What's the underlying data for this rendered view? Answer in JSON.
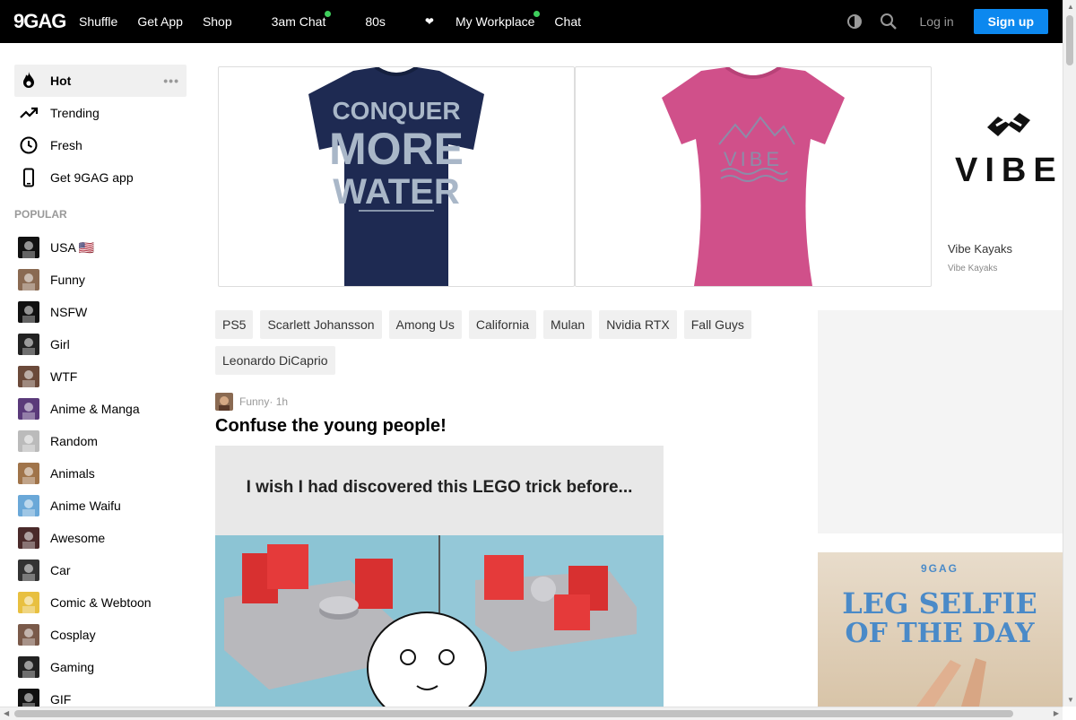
{
  "header": {
    "logo": "9GAG",
    "nav": [
      {
        "glyph": "",
        "label": "Shuffle",
        "dot": false
      },
      {
        "glyph": "",
        "label": "Get App",
        "dot": false
      },
      {
        "glyph": "",
        "label": "Shop",
        "dot": false
      },
      {
        "glyph": "",
        "label": "",
        "dot": false
      },
      {
        "glyph": "",
        "label": "3am Chat",
        "dot": true
      },
      {
        "glyph": "",
        "label": "",
        "dot": false
      },
      {
        "glyph": "",
        "label": "80s",
        "dot": false
      },
      {
        "glyph": "",
        "label": "",
        "dot": false
      },
      {
        "glyph": "❤",
        "label": "",
        "dot": false
      },
      {
        "glyph": "",
        "label": "My Workplace",
        "dot": true
      },
      {
        "glyph": "",
        "label": "Chat",
        "dot": false
      }
    ],
    "login": "Log in",
    "signup": "Sign up"
  },
  "sidebar": {
    "primary": [
      {
        "label": "Hot",
        "icon": "fire-icon"
      },
      {
        "label": "Trending",
        "icon": "trending-icon"
      },
      {
        "label": "Fresh",
        "icon": "clock-icon"
      },
      {
        "label": "Get 9GAG app",
        "icon": "phone-icon"
      }
    ],
    "more": "•••",
    "popular_heading": "POPULAR",
    "popular": [
      {
        "label": "USA 🇺🇸",
        "color": "#111111"
      },
      {
        "label": "Funny",
        "color": "#8a6a52"
      },
      {
        "label": "NSFW",
        "color": "#111111"
      },
      {
        "label": "Girl",
        "color": "#222222"
      },
      {
        "label": "WTF",
        "color": "#6b4a3a"
      },
      {
        "label": "Anime & Manga",
        "color": "#5a3a7a"
      },
      {
        "label": "Random",
        "color": "#bbbbbb"
      },
      {
        "label": "Animals",
        "color": "#a0744a"
      },
      {
        "label": "Anime Waifu",
        "color": "#6aa8d8"
      },
      {
        "label": "Awesome",
        "color": "#4a2a2a"
      },
      {
        "label": "Car",
        "color": "#333333"
      },
      {
        "label": "Comic & Webtoon",
        "color": "#e8c040"
      },
      {
        "label": "Cosplay",
        "color": "#7a5a4a"
      },
      {
        "label": "Gaming",
        "color": "#222222"
      },
      {
        "label": "GIF",
        "color": "#111111"
      }
    ]
  },
  "ad": {
    "shirt1_text": [
      "CONQUER",
      "MORE",
      "WATER"
    ],
    "shirt2_text": "VIBE",
    "brand_logo": "VIBE",
    "brand_name": "Vibe Kayaks",
    "brand_sub": "Vibe Kayaks"
  },
  "tags": [
    "PS5",
    "Scarlett Johansson",
    "Among Us",
    "California",
    "Mulan",
    "Nvidia RTX",
    "Fall Guys",
    "Leonardo DiCaprio"
  ],
  "post": {
    "section": "Funny",
    "age": " · 1h",
    "title": "Confuse the young people!",
    "image_caption": "I wish I had discovered this LEGO trick before..."
  },
  "right_ad": {
    "brand": "9GAG",
    "headline_1": "LEG SELFIE",
    "headline_2": "OF THE DAY"
  },
  "colors": {
    "accent": "#0c88ef",
    "online_dot": "#3ecf5c",
    "topbar": "#000000"
  }
}
